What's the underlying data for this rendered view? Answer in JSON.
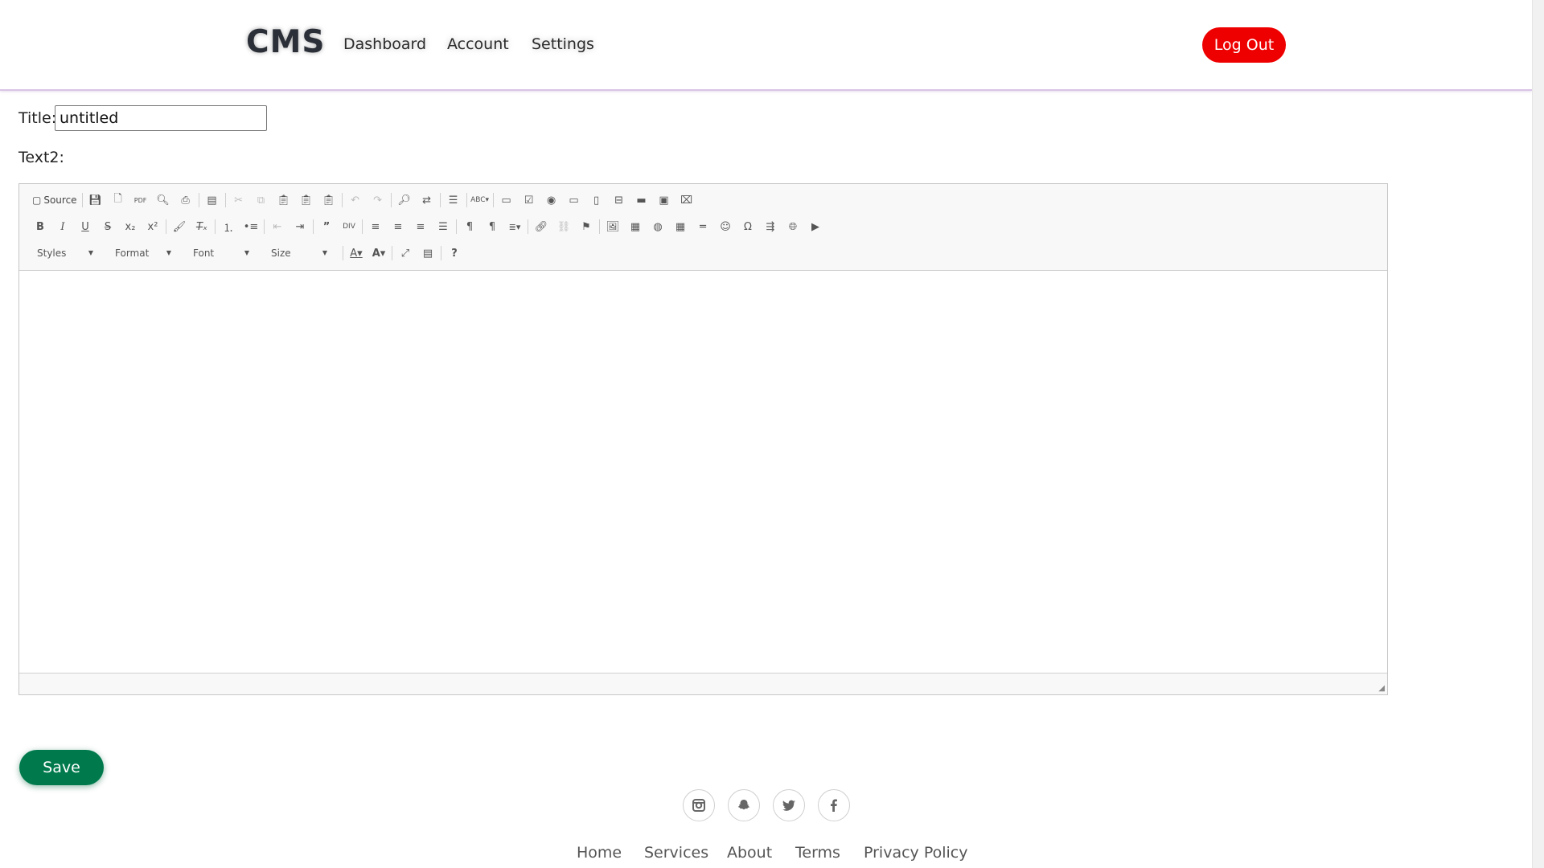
{
  "header": {
    "brand": "CMS",
    "nav": [
      "Dashboard",
      "Account",
      "Settings"
    ],
    "logout_label": "Log Out"
  },
  "form": {
    "title_label": "Title:",
    "title_value": "untitled",
    "text_label": "Text2:"
  },
  "editor": {
    "source_label": "Source",
    "combos": [
      "Styles",
      "Format",
      "Font",
      "Size"
    ],
    "toolbar_row1_icons": [
      "source-icon",
      "save-doc-icon",
      "new-page-icon",
      "export-pdf-icon",
      "preview-icon",
      "print-icon",
      "templates-icon",
      "cut-icon",
      "copy-icon",
      "paste-icon",
      "paste-text-icon",
      "paste-word-icon",
      "undo-icon",
      "redo-icon",
      "find-icon",
      "replace-icon",
      "select-all-icon",
      "spellcheck-icon",
      "form-icon",
      "checkbox-icon",
      "radio-icon",
      "textfield-icon",
      "textarea-icon",
      "select-field-icon",
      "button-icon",
      "image-button-icon",
      "hidden-field-icon"
    ],
    "toolbar_row2_icons": [
      "bold-icon",
      "italic-icon",
      "underline-icon",
      "strikethrough-icon",
      "subscript-icon",
      "superscript-icon",
      "copy-format-icon",
      "remove-format-icon",
      "numbered-list-icon",
      "bulleted-list-icon",
      "outdent-icon",
      "indent-icon",
      "blockquote-icon",
      "div-container-icon",
      "align-left-icon",
      "align-center-icon",
      "align-right-icon",
      "justify-icon",
      "ltr-icon",
      "rtl-icon",
      "language-icon",
      "link-icon",
      "unlink-icon",
      "anchor-icon",
      "image-icon",
      "flash-icon",
      "iframe-icon",
      "table-icon",
      "horizontal-line-icon",
      "smiley-icon",
      "special-char-icon",
      "page-break-icon",
      "iframe-globe-icon",
      "youtube-icon"
    ],
    "toolbar_row3_icons": [
      "text-color-icon",
      "background-color-icon",
      "maximize-icon",
      "show-blocks-icon",
      "help-icon"
    ]
  },
  "save_label": "Save",
  "footer": {
    "social_icons": [
      "instagram-icon",
      "snapchat-icon",
      "twitter-icon",
      "facebook-icon"
    ],
    "links": [
      "Home",
      "Services",
      "About",
      "Terms",
      "Privacy Policy"
    ]
  },
  "colors": {
    "logout_bg": "#ee0000",
    "save_bg": "#007a4d",
    "header_border": "#d9c4e6"
  }
}
